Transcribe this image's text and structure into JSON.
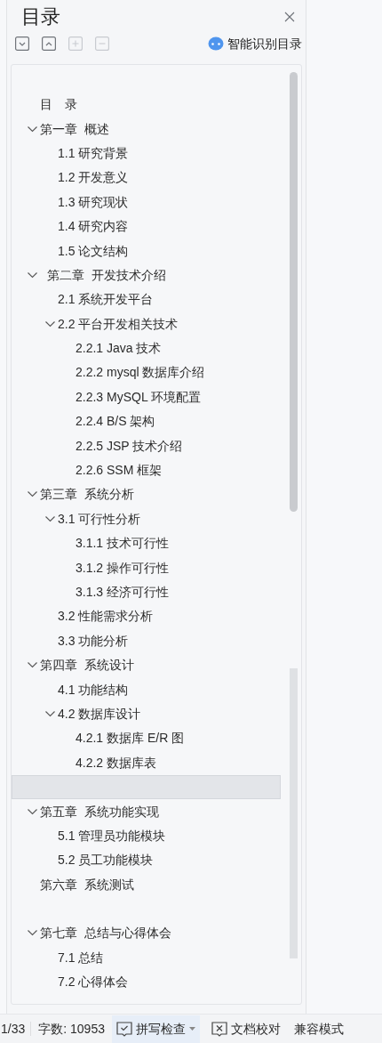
{
  "panel": {
    "title": "目录",
    "toolbar": [
      {
        "kind": "collapse",
        "disabled": false
      },
      {
        "kind": "expand",
        "disabled": false
      },
      {
        "kind": "add",
        "disabled": true
      },
      {
        "kind": "remove",
        "disabled": true
      }
    ],
    "smart_button": "智能识别目录"
  },
  "toc": [
    {
      "title": "目　录",
      "selected": false
    },
    {
      "title": "第一章  概述",
      "selected": false,
      "expanded": true,
      "children": [
        {
          "title": "1.1 研究背景",
          "selected": false
        },
        {
          "title": "1.2 开发意义",
          "selected": false
        },
        {
          "title": "1.3 研究现状",
          "selected": false
        },
        {
          "title": "1.4 研究内容",
          "selected": false
        },
        {
          "title": "1.5 论文结构",
          "selected": false
        }
      ]
    },
    {
      "title": "  第二章  开发技术介绍",
      "selected": false,
      "expanded": true,
      "children": [
        {
          "title": "2.1 系统开发平台",
          "selected": false
        },
        {
          "title": "2.2 平台开发相关技术",
          "selected": false,
          "expanded": true,
          "children": [
            {
              "title": "2.2.1 Java 技术",
              "selected": false
            },
            {
              "title": "2.2.2 mysql 数据库介绍",
              "selected": false
            },
            {
              "title": "2.2.3 MySQL 环境配置",
              "selected": false
            },
            {
              "title": "2.2.4 B/S 架构",
              "selected": false
            },
            {
              "title": "2.2.5 JSP 技术介绍",
              "selected": false
            },
            {
              "title": "2.2.6 SSM 框架",
              "selected": false
            }
          ]
        }
      ]
    },
    {
      "title": "第三章  系统分析",
      "selected": false,
      "expanded": true,
      "children": [
        {
          "title": "3.1 可行性分析",
          "selected": false,
          "expanded": true,
          "children": [
            {
              "title": "3.1.1 技术可行性",
              "selected": false
            },
            {
              "title": "3.1.2 操作可行性",
              "selected": false
            },
            {
              "title": "3.1.3 经济可行性",
              "selected": false
            }
          ]
        },
        {
          "title": "3.2 性能需求分析",
          "selected": false
        },
        {
          "title": "3.3 功能分析",
          "selected": false
        }
      ]
    },
    {
      "title": "第四章  系统设计",
      "selected": false,
      "expanded": true,
      "children": [
        {
          "title": "4.1 功能结构",
          "selected": false
        },
        {
          "title": "4.2 数据库设计",
          "selected": false,
          "expanded": true,
          "children": [
            {
              "title": "4.2.1 数据库 E/R 图",
              "selected": false
            },
            {
              "title": "4.2.2 数据库表",
              "selected": false
            }
          ]
        }
      ]
    },
    {
      "selected": true
    },
    {
      "title": "第五章  系统功能实现",
      "selected": false,
      "expanded": true,
      "children": [
        {
          "title": "5.1 管理员功能模块",
          "selected": false
        },
        {
          "title": "5.2 员工功能模块",
          "selected": false
        }
      ]
    },
    {
      "title": "第六章  系统测试",
      "selected": false
    },
    {
      "selected": false
    },
    {
      "title": "第七章  总结与心得体会",
      "selected": false,
      "expanded": true,
      "children": [
        {
          "title": "7.1 总结",
          "selected": false
        },
        {
          "title": "7.2 心得体会",
          "selected": false
        }
      ]
    }
  ],
  "status_bar": {
    "page": "1/33",
    "word_count": "字数: 10953",
    "items": [
      {
        "kind": "spell",
        "label": "拼写检查",
        "selected": true
      },
      {
        "kind": "proof",
        "label": "文档校对",
        "selected": false
      }
    ],
    "mode": "兼容模式"
  }
}
